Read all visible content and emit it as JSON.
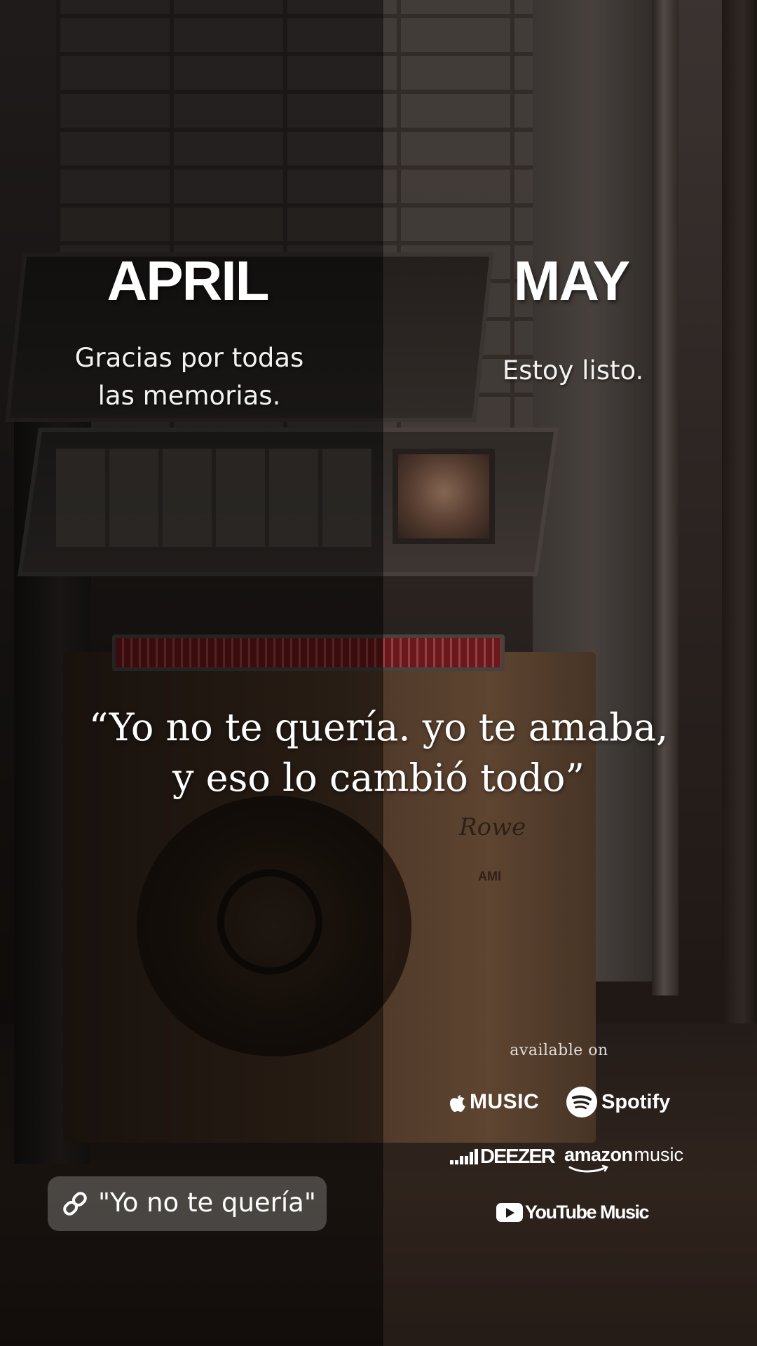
{
  "left_panel": {
    "month": "APRIL",
    "subtitle_line1": "Gracias por todas",
    "subtitle_line2": "las memorias."
  },
  "right_panel": {
    "month": "MAY",
    "subtitle": "Estoy listo."
  },
  "quote": {
    "line1": "“Yo no te quería. yo te amaba,",
    "line2": "y eso lo cambió todo”"
  },
  "jukebox_text": {
    "script": "Rowe",
    "brand": "AMI"
  },
  "streaming": {
    "heading": "available on",
    "apple_music": "MUSIC",
    "spotify": "Spotify",
    "deezer": "DEEZER",
    "amazon": "amazon",
    "amazon_music": "music",
    "youtube_music": "YouTube Music"
  },
  "link_sticker": {
    "label": "\"Yo no te quería\"",
    "icon": "link-icon"
  },
  "colors": {
    "overlay_left": "#000000",
    "text": "#ffffff"
  }
}
